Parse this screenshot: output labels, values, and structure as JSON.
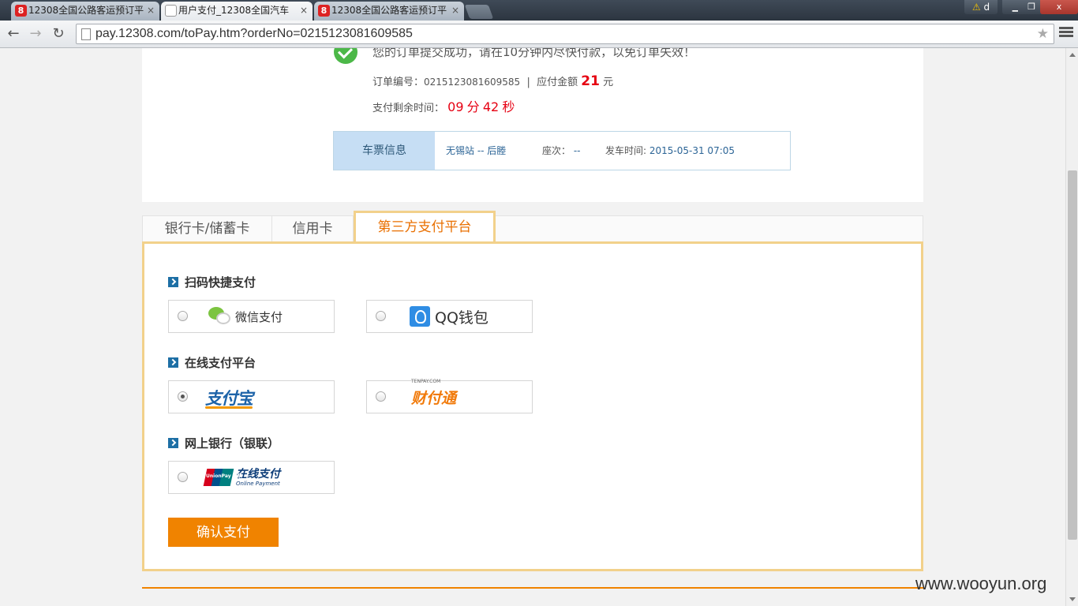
{
  "browser": {
    "tabs": [
      {
        "title": "12308全国公路客运预订平",
        "favicon": "12308-logo-icon"
      },
      {
        "title": "用户支付_12308全国汽车",
        "favicon": "page-icon"
      },
      {
        "title": "12308全国公路客运预订平",
        "favicon": "12308-logo-icon"
      }
    ],
    "favicon_glyph": "8",
    "close_glyph": "×",
    "user_label": "d",
    "warning_glyph": "⚠",
    "minimize_glyph": "▁",
    "restore_glyph": "❐",
    "window_close_glyph": "x",
    "back_glyph": "←",
    "forward_glyph": "→",
    "reload_glyph": "↻",
    "star_glyph": "★",
    "url": "pay.12308.com/toPay.htm?orderNo=0215123081609585"
  },
  "order": {
    "success_message": "您的订单提交成功，请在10分钟内尽快付款，以免订单失效！",
    "order_no_label": "订单编号：",
    "order_no": "0215123081609585",
    "separator": "|",
    "amount_label": "应付金额",
    "amount": "21",
    "amount_unit": "元",
    "remaining_label": "支付剩余时间：",
    "minutes": "09",
    "minutes_unit": "分",
    "seconds": "42",
    "seconds_unit": "秒"
  },
  "ticket": {
    "label": "车票信息",
    "route": "无锡站 -- 后塍",
    "seat_label": "座次：",
    "seat_value": "--",
    "depart_label": "发车时间:",
    "depart_value": "2015-05-31 07:05"
  },
  "pay_tabs": [
    {
      "label": "银行卡/储蓄卡"
    },
    {
      "label": "信用卡"
    },
    {
      "label": "第三方支付平台",
      "active": true
    }
  ],
  "sections": {
    "scan": {
      "title": "扫码快捷支付"
    },
    "online": {
      "title": "在线支付平台"
    },
    "bank": {
      "title": "网上银行（银联）"
    }
  },
  "options": {
    "wechat": {
      "label": "微信支付",
      "checked": false
    },
    "qq": {
      "label": "QQ钱包",
      "checked": false
    },
    "alipay": {
      "label": "支付宝",
      "checked": true
    },
    "tenpay": {
      "label": "财付通",
      "small": "TENPAY.COM",
      "checked": false
    },
    "unionpay": {
      "label": "在线支付",
      "sublabel": "Online Payment",
      "mark": "UnionPay 银联",
      "checked": false
    }
  },
  "confirm_label": "确认支付",
  "footer_text": "",
  "watermark": "www.wooyun.org",
  "colors": {
    "accent_orange": "#f08300",
    "tab_border": "#f2d18b",
    "amount_red": "#e60012",
    "ticket_label_bg": "#c6def4"
  }
}
